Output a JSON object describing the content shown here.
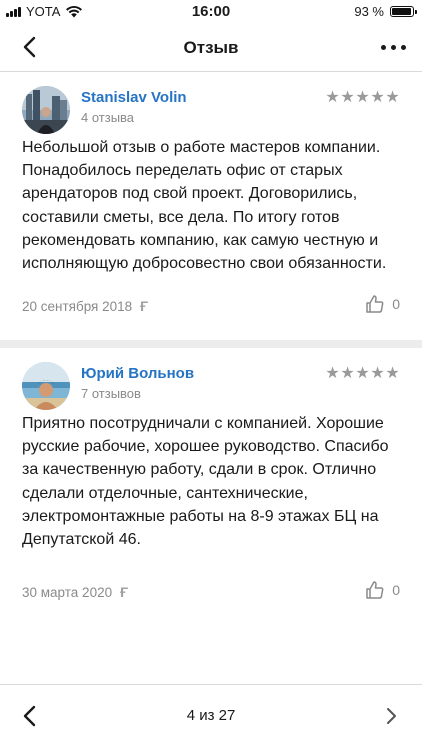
{
  "status_bar": {
    "carrier": "YOTA",
    "time": "16:00",
    "battery_percent": "93 %",
    "battery_level": 0.93
  },
  "header": {
    "title": "Отзыв",
    "back_icon": "chevron-left-icon",
    "more_icon": "more-dots-icon"
  },
  "reviews": [
    {
      "author": "Stanislav Volin",
      "reviews_count": "4 отзыва",
      "rating": 5,
      "text": "Небольшой отзыв о работе мастеров компании. Понадобилось переделать офис от старых арендаторов под свой проект. Договорились, составили сметы, все дела. По итогу готов рекомендовать компанию, как самую честную и исполняющую добросовестно свои обязанности.",
      "date": "20 сентября 2018",
      "likes": "0"
    },
    {
      "author": "Юрий Вольнов",
      "reviews_count": "7 отзывов",
      "rating": 5,
      "text": "Приятно посотрудничали с компанией. Хорошие русские рабочие, хорошее руководство. Спасибо за качественную работу, сдали в срок.  Отлично сделали отделочные, сантехнические, электромонтажные работы на 8-9 этажах БЦ на Депутатской 46.",
      "date": "30 марта 2020",
      "likes": "0"
    }
  ],
  "pager": {
    "label": "4 из 27"
  },
  "colors": {
    "author_link": "#2575c4",
    "muted_text": "#8a8a8a",
    "star": "#9a9a9a",
    "separator": "#ececec"
  }
}
